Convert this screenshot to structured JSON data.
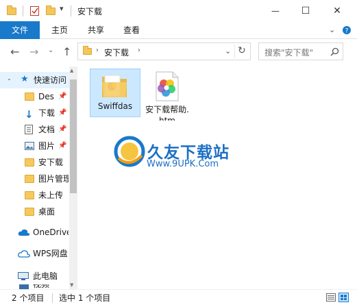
{
  "window": {
    "title": "安下载",
    "controls": {
      "minimize": "—",
      "maximize": "☐",
      "close": "✕"
    }
  },
  "ribbon": {
    "tabs": [
      {
        "label": "文件",
        "active": true
      },
      {
        "label": "主页"
      },
      {
        "label": "共享"
      },
      {
        "label": "查看"
      }
    ],
    "accent": "#1979ca"
  },
  "address": {
    "path": [
      "安下载"
    ],
    "search_placeholder": "搜索\"安下载\""
  },
  "nav": {
    "quick_access": "快速访问",
    "items": [
      {
        "label": "Des",
        "icon": "folder-icon",
        "pinned": true
      },
      {
        "label": "下载",
        "icon": "download-arrow-icon",
        "pinned": true
      },
      {
        "label": "文档",
        "icon": "document-icon",
        "pinned": true
      },
      {
        "label": "图片",
        "icon": "picture-icon",
        "pinned": true
      },
      {
        "label": "安下载",
        "icon": "folder-icon"
      },
      {
        "label": "图片管理",
        "icon": "folder-icon"
      },
      {
        "label": "未上传",
        "icon": "folder-icon"
      },
      {
        "label": "桌面",
        "icon": "folder-icon"
      }
    ],
    "onedrive": "OneDrive",
    "wps": "WPS网盘",
    "thispc": "此电脑",
    "video": "视频"
  },
  "files": [
    {
      "name": "Swiffdas",
      "icon": "folder-icon",
      "selected": true
    },
    {
      "name": "安下载帮助.htm",
      "icon": "htm-file-icon",
      "selected": false
    }
  ],
  "watermark": {
    "brand": "久友下载站",
    "url": "Www.9UPK.Com"
  },
  "status": {
    "count": "2 个项目",
    "selected": "选中 1 个项目"
  }
}
